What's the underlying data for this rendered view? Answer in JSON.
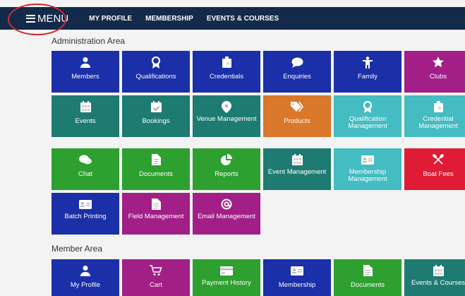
{
  "nav": {
    "menu_label": "MENU",
    "links": [
      "MY PROFILE",
      "MEMBERSHIP",
      "EVENTS & COURSES"
    ],
    "colors": {
      "bar": "#132a4a",
      "highlight_ring": "#d32a2a"
    }
  },
  "admin": {
    "title": "Administration Area",
    "tiles": [
      {
        "label": "Members",
        "icon": "user-icon",
        "color": "#1b2fa8"
      },
      {
        "label": "Qualifications",
        "icon": "award-icon",
        "color": "#1b2fa8"
      },
      {
        "label": "Credentials",
        "icon": "badge-card-icon",
        "color": "#1b2fa8"
      },
      {
        "label": "Enquiries",
        "icon": "chat-bubble-icon",
        "color": "#1b2fa8"
      },
      {
        "label": "Family",
        "icon": "family-icon",
        "color": "#1b2fa8"
      },
      {
        "label": "Clubs",
        "icon": "star-icon",
        "color": "#a11f86"
      },
      {
        "label": "Events",
        "icon": "calendar-icon",
        "color": "#1e7b72"
      },
      {
        "label": "Bookings",
        "icon": "calendar-check-icon",
        "color": "#1e7b72"
      },
      {
        "label": "Venue Management",
        "icon": "map-pin-icon",
        "color": "#1e7b72"
      },
      {
        "label": "Products",
        "icon": "tag-icon",
        "color": "#d9772a"
      },
      {
        "label": "Qualification Management",
        "icon": "award-icon",
        "color": "#44bcc2"
      },
      {
        "label": "Credential Management",
        "icon": "badge-card-icon",
        "color": "#44bcc2"
      },
      {
        "label": "Chat",
        "icon": "chat-icon",
        "color": "#2ea02f"
      },
      {
        "label": "Documents",
        "icon": "document-icon",
        "color": "#2ea02f"
      },
      {
        "label": "Reports",
        "icon": "pie-chart-icon",
        "color": "#2ea02f"
      },
      {
        "label": "Event Management",
        "icon": "calendar-icon",
        "color": "#1e7b72"
      },
      {
        "label": "Membership Management",
        "icon": "id-card-icon",
        "color": "#44bcc2"
      },
      {
        "label": "Boat Fees",
        "icon": "oars-icon",
        "color": "#e01b35"
      },
      {
        "label": "Batch Printing",
        "icon": "id-card-icon",
        "color": "#1b2fa8"
      },
      {
        "label": "Field Management",
        "icon": "document-icon",
        "color": "#a11f86"
      },
      {
        "label": "Email Management",
        "icon": "at-sign-icon",
        "color": "#a11f86"
      }
    ]
  },
  "member": {
    "title": "Member Area",
    "tiles": [
      {
        "label": "My Profile",
        "icon": "user-icon",
        "color": "#1b2fa8"
      },
      {
        "label": "Cart",
        "icon": "cart-icon",
        "color": "#a11f86"
      },
      {
        "label": "Payment History",
        "icon": "credit-card-icon",
        "color": "#2ea02f"
      },
      {
        "label": "Membership",
        "icon": "id-card-icon",
        "color": "#1b2fa8"
      },
      {
        "label": "Documents",
        "icon": "document-icon",
        "color": "#2ea02f"
      },
      {
        "label": "Events & Courses",
        "icon": "calendar-icon",
        "color": "#1e7b72"
      }
    ]
  }
}
